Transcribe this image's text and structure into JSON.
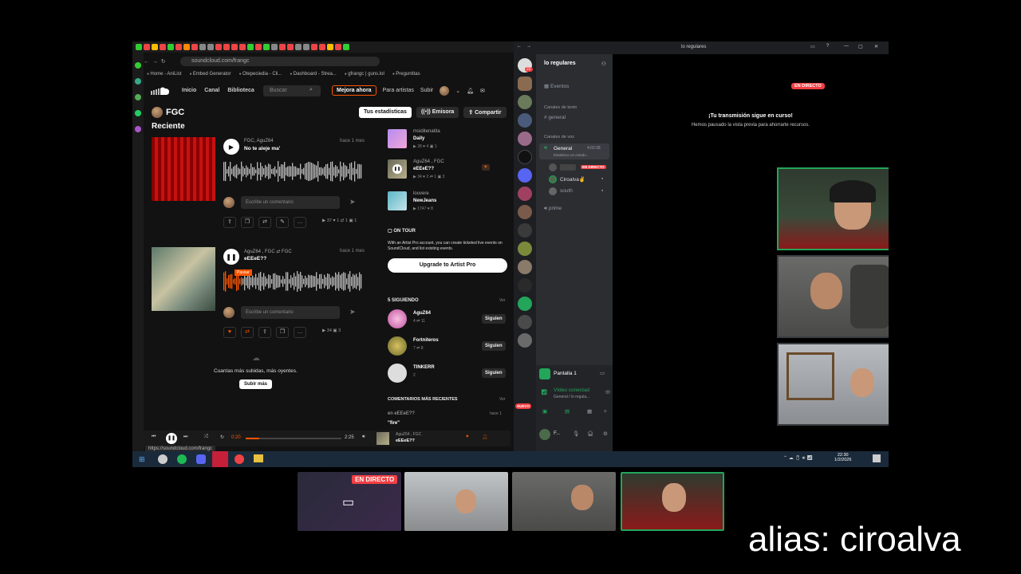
{
  "browser": {
    "url": "soundcloud.com/frangc",
    "bookmarks": [
      "Home - AniList",
      "Embed Generator",
      "Otepeciedia - Cli...",
      "Dashboard - Strea...",
      "gfrangc | guns.lol",
      "Preguntitas"
    ],
    "status_url": "https://soundcloud.com/frangc"
  },
  "soundcloud": {
    "nav": [
      "Inicio",
      "Canal",
      "Biblioteca"
    ],
    "search_placeholder": "Buscar",
    "upgrade_btn": "Mejora ahora",
    "artists_link": "Para artistas",
    "upload_link": "Subir",
    "profile_name": "FGC",
    "tabs": {
      "stats": "Tus estadísticas",
      "station": "Emisora",
      "share": "Compartir"
    },
    "section_recent": "Reciente",
    "tracks": [
      {
        "artist": "FGC, AguZ64",
        "title": "No te aleje ma'",
        "time": "hace 1 mes",
        "comment_placeholder": "Escribe un comentario",
        "stats": "▶ 37 ♥ 1 ⇄ 1 ▣ 1"
      },
      {
        "artist": "AguZ64 , FGC ⇄ FGC",
        "title": "eEEeE??",
        "time": "hace 1 mes",
        "comment_placeholder": "Escribe un comentario",
        "stats": "▶ 34 ▣ 3",
        "tooltip": "Pausar"
      }
    ],
    "more_text": "Cuantas más subidas, más oyentes.",
    "upload_more": "Subir más",
    "right": {
      "liked": [
        {
          "name": "msiditenatita",
          "title": "Daily",
          "stats": "▶ 28 ♥ 4 ▣ 1"
        },
        {
          "name": "AguZ64 , FGC",
          "title": "eEEeE??",
          "stats": "▶ 34 ♥ 2 ⇄ 1 ▣ 3"
        },
        {
          "name": "louvere",
          "title": "NewJeans",
          "stats": "▶ 1747 ♥ 8"
        }
      ],
      "on_tour": "ON TOUR",
      "tour_text": "With an Artist Pro account, you can create ticketed live events on SoundCloud, and list existing events.",
      "upgrade_pro": "Upgrade to Artist Pro",
      "following_title": "5 SIGUIENDO",
      "view_all": "Ver",
      "following": [
        {
          "name": "AguZ64",
          "stats": "4 ⇄ 11"
        },
        {
          "name": "Fortniteros",
          "stats": "7 ⇄ 8"
        },
        {
          "name": "TINKERR",
          "stats": "2"
        }
      ],
      "follow_btn": "Siguien",
      "comments_title": "COMENTARIOS MÁS RECIENTES",
      "comment_on": "en eEEeE??",
      "comment_time": "hace 1",
      "comment_text": "\"fire\""
    },
    "player": {
      "elapsed": "0:20",
      "duration": "2:25",
      "artist": "AguZ64 , FGC",
      "title": "eEEeE??"
    }
  },
  "discord": {
    "server_name": "lo regulares",
    "top_title": "lo regulares",
    "events": "Eventos",
    "text_channels": "Canales de texto",
    "general_text": "general",
    "voice_channels": "Canales de voz",
    "voice_general": "General",
    "voice_timer": "4:02:28",
    "voice_status": "Establece un estado...",
    "live_badge": "EN DIRECTO",
    "members": [
      "Ciroalva✌",
      "south"
    ],
    "prime": "prime",
    "new_badge": "NUEVO",
    "notif_count": "22",
    "screen_label": "Pantalla 1",
    "video_connected": "Vídeo conectad",
    "video_path": "General / lo regula...",
    "user_initial": "F...",
    "stream_live": "EN DIRECTO",
    "stream_msg_title": "¡Tu transmisión sigue en curso!",
    "stream_msg_sub": "Hemos pausado la vista previa para ahorrarte recursos."
  },
  "taskbar": {
    "time": "22:30",
    "date": "1/2/2026"
  },
  "bottom": {
    "live_badge": "EN DIRECTO",
    "alias": "alias: ciroalva"
  }
}
